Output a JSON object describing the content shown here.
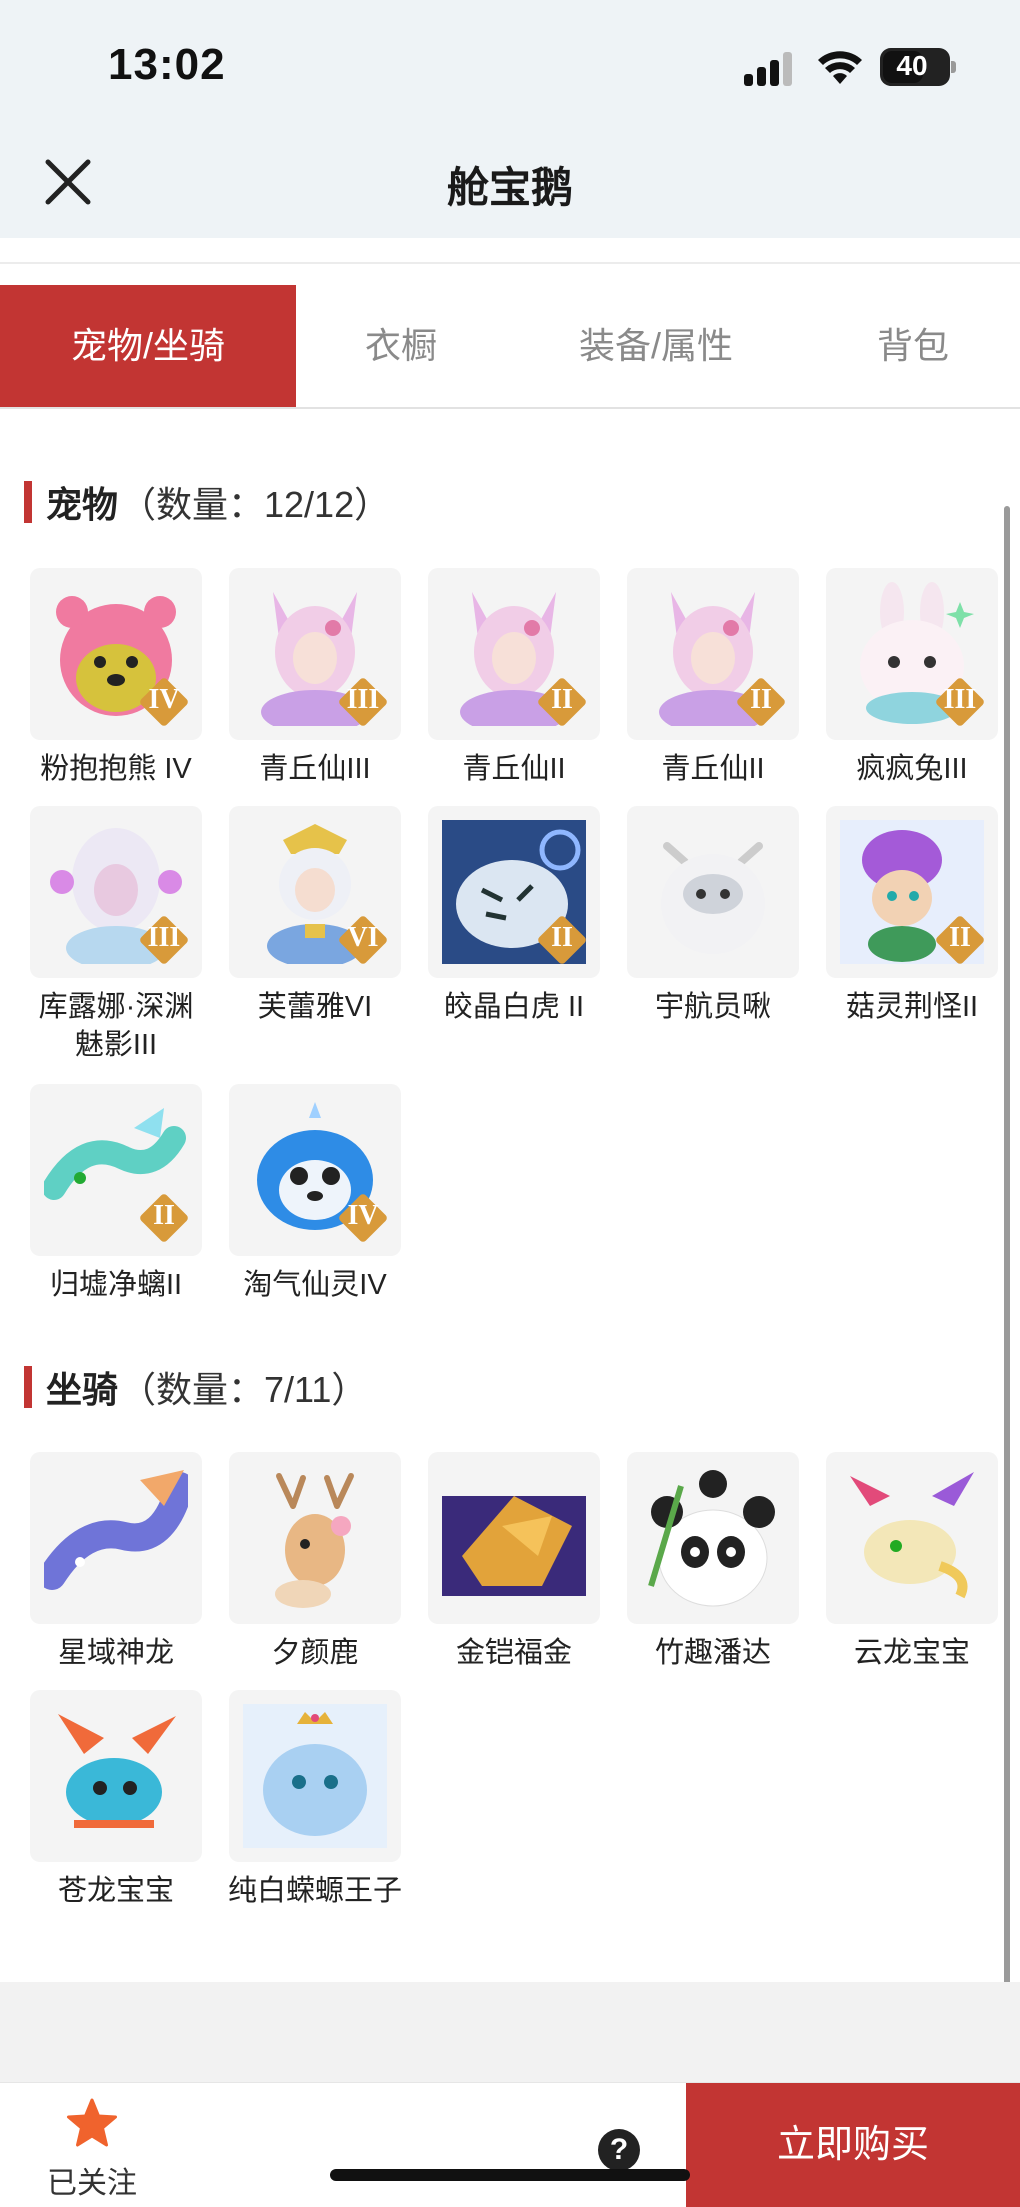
{
  "status_bar": {
    "time": "13:02",
    "battery": "40"
  },
  "nav": {
    "title": "舱宝鹅"
  },
  "tabs": [
    {
      "label": "宠物/坐骑",
      "active": true
    },
    {
      "label": "衣橱",
      "active": false
    },
    {
      "label": "装备/属性",
      "active": false
    },
    {
      "label": "背包",
      "active": false
    }
  ],
  "pets": {
    "title": "宠物",
    "count_text": "（数量：12/12）",
    "items": [
      {
        "name": "粉抱抱熊 IV",
        "tier": "IV",
        "icon": "pink-bear-icon"
      },
      {
        "name": "青丘仙III",
        "tier": "III",
        "icon": "fox-fairy-icon"
      },
      {
        "name": "青丘仙II",
        "tier": "II",
        "icon": "fox-fairy-icon"
      },
      {
        "name": "青丘仙II",
        "tier": "II",
        "icon": "fox-fairy-icon"
      },
      {
        "name": "疯疯兔III",
        "tier": "III",
        "icon": "rabbit-icon"
      },
      {
        "name": "库露娜·深渊魅影III",
        "tier": "III",
        "icon": "abyss-girl-icon"
      },
      {
        "name": "芙蕾雅VI",
        "tier": "VI",
        "icon": "valkyrie-icon"
      },
      {
        "name": "皎晶白虎 II",
        "tier": "II",
        "icon": "white-tiger-icon"
      },
      {
        "name": "宇航员啾",
        "tier": "",
        "icon": "astronaut-icon"
      },
      {
        "name": "菇灵荆怪II",
        "tier": "II",
        "icon": "mushroom-sprite-icon"
      },
      {
        "name": "归墟净螭II",
        "tier": "II",
        "icon": "sea-dragon-icon"
      },
      {
        "name": "淘气仙灵IV",
        "tier": "IV",
        "icon": "blue-puppy-icon"
      }
    ]
  },
  "mounts": {
    "title": "坐骑",
    "count_text": "（数量：7/11）",
    "items": [
      {
        "name": "星域神龙",
        "icon": "star-dragon-icon"
      },
      {
        "name": "夕颜鹿",
        "icon": "deer-icon"
      },
      {
        "name": "金铠福金",
        "icon": "golden-armor-icon"
      },
      {
        "name": "竹趣潘达",
        "icon": "panda-icon"
      },
      {
        "name": "云龙宝宝",
        "icon": "cloud-dragon-icon"
      },
      {
        "name": "苍龙宝宝",
        "icon": "azure-dragon-icon"
      },
      {
        "name": "纯白蝾螈王子",
        "icon": "white-axolotl-icon"
      }
    ]
  },
  "bottom": {
    "follow_label": "已关注",
    "help": "?",
    "buy_label": "立即购买"
  },
  "colors": {
    "accent": "#c23533",
    "tier_badge": "#d89a3a"
  }
}
